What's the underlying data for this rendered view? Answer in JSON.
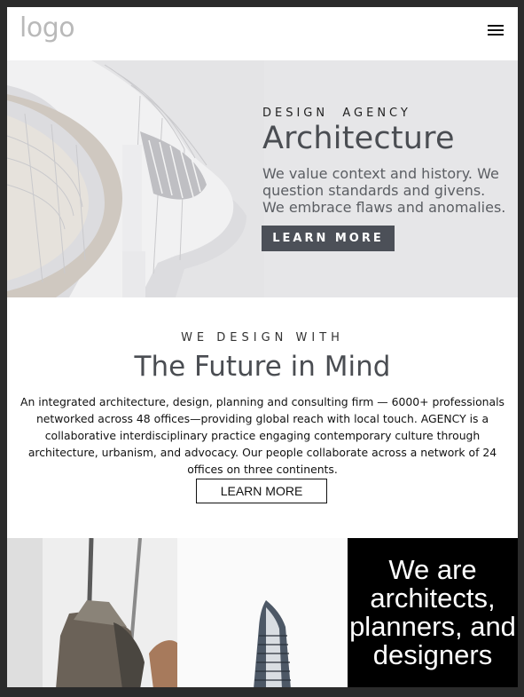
{
  "header": {
    "logo": "logo",
    "menu_icon": "hamburger-icon"
  },
  "hero": {
    "kicker": "DESIGN  AGENCY",
    "title": "Architecture",
    "text": "We value context and history. We question standards and givens. We embrace flaws and anomalies.",
    "button_label": "LEARN MORE"
  },
  "future": {
    "kicker": "WE DESIGN WITH",
    "title": "The Future in Mind",
    "text": "An integrated architecture, design, planning and consulting firm — 6000+ professionals networked across 48 offices—providing global reach with local touch. AGENCY is a collaborative interdisciplinary practice engaging contemporary culture through architecture, urbanism, and advocacy. Our people collaborate across a network of 24 offices on three continents.",
    "button_label": "LEARN MORE"
  },
  "band": {
    "tagline": "We are architects, planners, and designers"
  },
  "colors": {
    "hero_bg": "#e6e6e8",
    "hero_button": "#4c5058",
    "heading": "#4a4d52",
    "tile_dark": "#000000"
  }
}
